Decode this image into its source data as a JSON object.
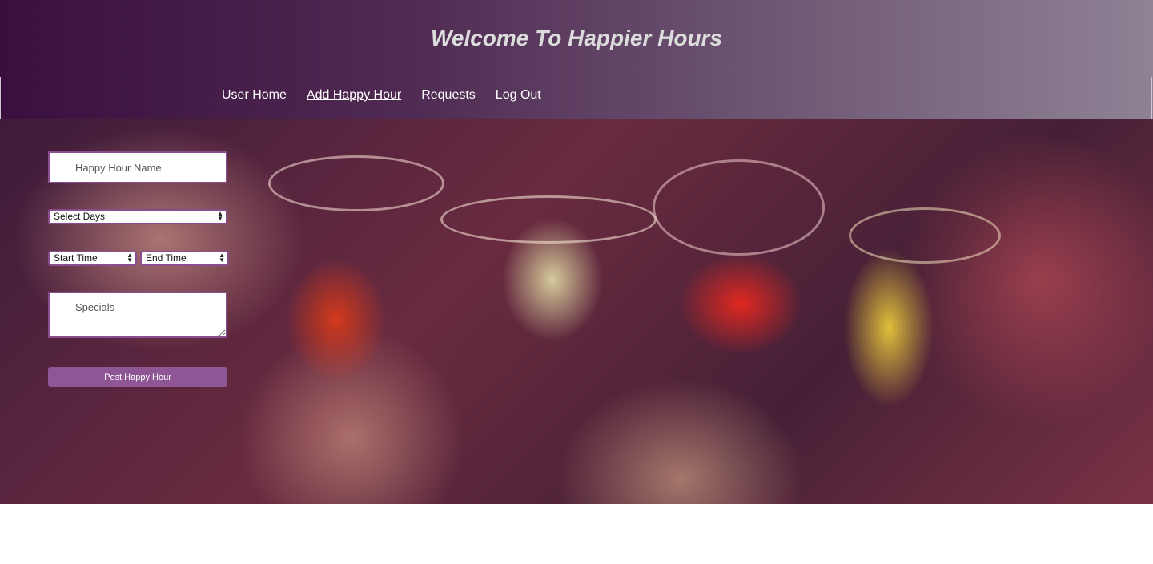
{
  "header": {
    "title": "Welcome To Happier Hours"
  },
  "nav": {
    "items": [
      {
        "label": "User Home",
        "active": false
      },
      {
        "label": "Add Happy Hour",
        "active": true
      },
      {
        "label": "Requests",
        "active": false
      },
      {
        "label": "Log Out",
        "active": false
      }
    ]
  },
  "form": {
    "name_placeholder": "Happy Hour Name",
    "days_select": "Select Days",
    "start_time_select": "Start Time",
    "end_time_select": "End Time",
    "specials_placeholder": "Specials",
    "submit_label": "Post Happy Hour"
  },
  "colors": {
    "header_start": "#3a0f3e",
    "header_end": "#8f8295",
    "accent": "#8e5695",
    "input_border": "#8a4d8f"
  }
}
